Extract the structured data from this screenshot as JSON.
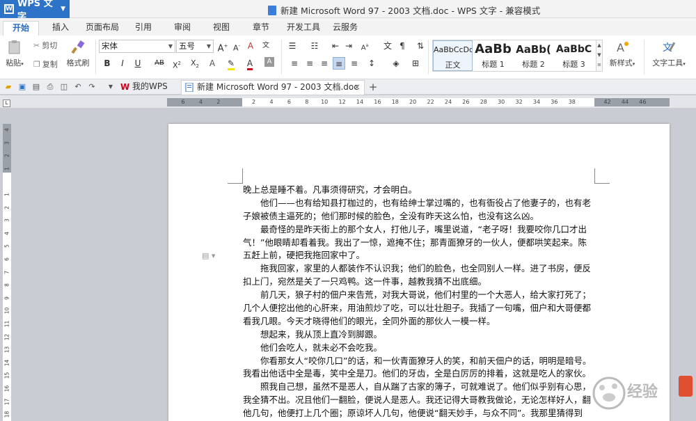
{
  "app": {
    "name": "WPS 文字",
    "window_title": "新建 Microsoft Word 97 - 2003 文档.doc - WPS 文字 - 兼容模式"
  },
  "ribbon_tabs": [
    "开始",
    "插入",
    "页面布局",
    "引用",
    "审阅",
    "视图",
    "章节",
    "开发工具",
    "云服务"
  ],
  "ribbon": {
    "paste": "粘贴",
    "cut": "剪切",
    "copy": "复制",
    "format_painter": "格式刷",
    "font_name": "宋体",
    "font_size": "五号",
    "styles": [
      {
        "sample": "AaBbCcDd",
        "name": "正文"
      },
      {
        "sample": "AaBb",
        "name": "标题 1"
      },
      {
        "sample": "AaBb(",
        "name": "标题 2"
      },
      {
        "sample": "AaBbC",
        "name": "标题 3"
      }
    ],
    "new_style": "新样式",
    "text_tools": "文字工具"
  },
  "doc_tabs": [
    {
      "label": "我的WPS",
      "active": false
    },
    {
      "label": "新建 Microsoft Word 97 - 2003 文档.doc",
      "active": true
    }
  ],
  "ruler_h": [
    "6",
    "4",
    "2",
    "",
    "2",
    "4",
    "6",
    "8",
    "10",
    "12",
    "14",
    "16",
    "18",
    "20",
    "22",
    "24",
    "26",
    "28",
    "30",
    "32",
    "34",
    "36",
    "38",
    "",
    "42",
    "44",
    "46"
  ],
  "ruler_v": [
    "4",
    "3",
    "2",
    "1",
    "",
    "1",
    "2",
    "3",
    "4",
    "5",
    "6",
    "7",
    "8",
    "9",
    "10",
    "11",
    "12",
    "13",
    "14",
    "15",
    "16",
    "17",
    "18",
    "19"
  ],
  "document": {
    "lines": [
      "晚上总是睡不着。凡事须得研究，才会明白。",
      "　　他们——也有给知县打枷过的，也有给绅士掌过嘴的，也有衙役占了他妻子的，也有老",
      "子娘被债主逼死的；他们那时候的脸色，全没有昨天这么怕，也没有这么凶。",
      "　　最奇怪的是昨天街上的那个女人，打他儿子，嘴里说道，“老子呀！我要咬你几口才出",
      "气！”他眼睛却看着我。我出了一惊，遮掩不住；那青面獠牙的一伙人，便都哄笑起来。陈　老",
      "五赶上前，硬把我拖回家中了。",
      "　　拖我回家，家里的人都装作不认识我；他们的脸色，也全同别人一样。进了书房，便反",
      "扣上门，宛然是关了一只鸡鸭。这一件事，越教我猜不出底细。",
      "　　前几天，狼子村的佃户来告荒，对我大哥说，他们村里的一个大恶人，给大家打死了；",
      "几个人便挖出他的心肝来，用油煎炒了吃，可以壮壮胆子。我插了一句嘴，佃户和大哥便都",
      "看我几眼。今天才晓得他们的眼光，全同外面的那伙人一模一样。",
      "　　想起来，我从顶上直冷到脚跟。",
      "　　他们会吃人，就未必不会吃我。",
      "　　你看那女人“咬你几口”的话，和一伙青面獠牙人的笑，和前天佃户的话，明明是暗号。",
      "我看出他话中全是毒，笑中全是刀。他们的牙齿，全是白厉厉的排着，这就是吃人的家伙。",
      "　　照我自己想，虽然不是恶人，自从踹了古家的簿子，可就难说了。他们似乎别有心思，",
      "我全猜不出。况且他们一翻脸，便说人是恶人。我还记得大哥教我做论，无论怎样好人，翻",
      "他几句，他便打上几个圈；原谅坏人几句，他便说“翻天妙手，与众不同”。我那里猜得到"
    ]
  },
  "watermark": {
    "text": "经验"
  },
  "colors": {
    "accent": "#2d73c8",
    "tab_active": "#2b6cc0"
  }
}
